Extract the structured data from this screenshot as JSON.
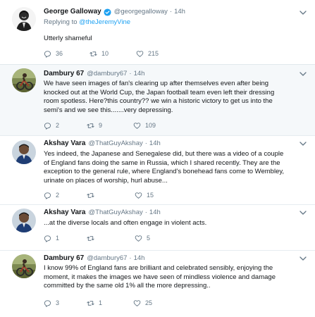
{
  "tweets": [
    {
      "name": "George Galloway",
      "handle": "@georgegalloway",
      "time": "14h",
      "replying_label": "Replying to",
      "replying_to": "@theJeremyVine",
      "text": "Utterly shameful",
      "replies": "36",
      "retweets": "10",
      "likes": "215"
    },
    {
      "name": "Dambury 67",
      "handle": "@dambury67",
      "time": "14h",
      "lines": [
        "We have seen images of fan's clearing up after themselves even after being",
        "knocked out at the World Cup, the Japan football team even left their dressing",
        "room spotless. Here?this country?? we win a historic victory to get us into the",
        "semi's and we see this.......very depressing."
      ],
      "replies": "2",
      "retweets": "9",
      "likes": "109"
    },
    {
      "name": "Akshay Vara",
      "handle": "@ThatGuyAkshay",
      "time": "14h",
      "lines": [
        "Yes indeed, the Japanese and Senegalese did, but there was a video of a couple",
        "of England fans doing the same in Russia, which I shared recently. They are the",
        "exception to the general rule, where England's bonehead fans come to Wembley,",
        "urinate on places of worship, hurl abuse..."
      ],
      "replies": "2",
      "retweets": "",
      "likes": "15"
    },
    {
      "name": "Akshay Vara",
      "handle": "@ThatGuyAkshay",
      "time": "14h",
      "lines": [
        "...at the diverse locals and often engage in violent acts."
      ],
      "replies": "1",
      "retweets": "",
      "likes": "5"
    },
    {
      "name": "Dambury 67",
      "handle": "@dambury67",
      "time": "14h",
      "lines": [
        "I know 99% of England fans are brilliant and celebrated sensibly, enjoying the",
        "moment, it makes the images we have seen of mindless violence and damage",
        "committed by the same old 1% all the more depressing.."
      ],
      "replies": "3",
      "retweets": "1",
      "likes": "25"
    }
  ],
  "dot": "·",
  "colors": {
    "link": "#1da1f2",
    "muted": "#657786",
    "verified": "#1da1f2"
  },
  "icons": [
    "reply-icon",
    "retweet-icon",
    "like-icon",
    "caret-down-icon",
    "verified-badge-icon"
  ]
}
